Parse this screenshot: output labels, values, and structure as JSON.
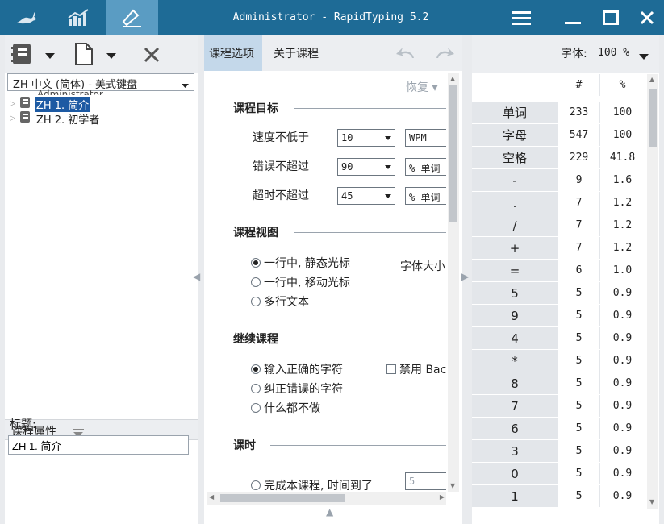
{
  "window": {
    "title": "Administrator - RapidTyping 5.2",
    "accent": "#1e6b96"
  },
  "left_panel": {
    "keyboard_select": "ZH 中文 (简体) - 美式键盘",
    "tree_ghost": "Administrator",
    "tree": [
      {
        "label": "ZH 1. 简介",
        "selected": true
      },
      {
        "label": "ZH 2. 初学者",
        "selected": false
      }
    ],
    "properties_label": "课程属性",
    "title_label": "标题:",
    "title_value": "ZH 1. 简介"
  },
  "mid_panel": {
    "tabs": [
      "课程选项",
      "关于课程"
    ],
    "restore_label": "恢复",
    "goal_section": "课程目标",
    "speed_label": "速度不低于",
    "speed_value": "10",
    "speed_unit": "WPM",
    "errors_label": "错误不超过",
    "errors_value": "90",
    "errors_unit": "% 单词",
    "timeout_label": "超时不超过",
    "timeout_value": "45",
    "timeout_unit": "% 单词",
    "view_section": "课程视图",
    "view_options": [
      "一行中, 静态光标",
      "一行中, 移动光标",
      "多行文本"
    ],
    "font_size_label": "字体大小",
    "continue_section": "继续课程",
    "continue_options": [
      "输入正确的字符",
      "纠正错误的字符",
      "什么都不做"
    ],
    "disable_label": "禁用 Bac",
    "lesson_section": "课时",
    "complete_label": "完成本课程, 时间到了",
    "time_value": "5"
  },
  "right_panel": {
    "font_label": "字体:",
    "font_value": "100 %",
    "col_count": "#",
    "col_pct": "%",
    "rows": [
      {
        "k": "单词",
        "n": "233",
        "p": "100"
      },
      {
        "k": "字母",
        "n": "547",
        "p": "100"
      },
      {
        "k": "空格",
        "n": "229",
        "p": "41.8"
      },
      {
        "k": "-",
        "n": "9",
        "p": "1.6"
      },
      {
        "k": ".",
        "n": "7",
        "p": "1.2"
      },
      {
        "k": "/",
        "n": "7",
        "p": "1.2"
      },
      {
        "k": "+",
        "n": "7",
        "p": "1.2"
      },
      {
        "k": "=",
        "n": "6",
        "p": "1.0"
      },
      {
        "k": "5",
        "n": "5",
        "p": "0.9"
      },
      {
        "k": "9",
        "n": "5",
        "p": "0.9"
      },
      {
        "k": "4",
        "n": "5",
        "p": "0.9"
      },
      {
        "k": "*",
        "n": "5",
        "p": "0.9"
      },
      {
        "k": "8",
        "n": "5",
        "p": "0.9"
      },
      {
        "k": "7",
        "n": "5",
        "p": "0.9"
      },
      {
        "k": "6",
        "n": "5",
        "p": "0.9"
      },
      {
        "k": "3",
        "n": "5",
        "p": "0.9"
      },
      {
        "k": "0",
        "n": "5",
        "p": "0.9"
      },
      {
        "k": "1",
        "n": "5",
        "p": "0.9"
      }
    ]
  }
}
